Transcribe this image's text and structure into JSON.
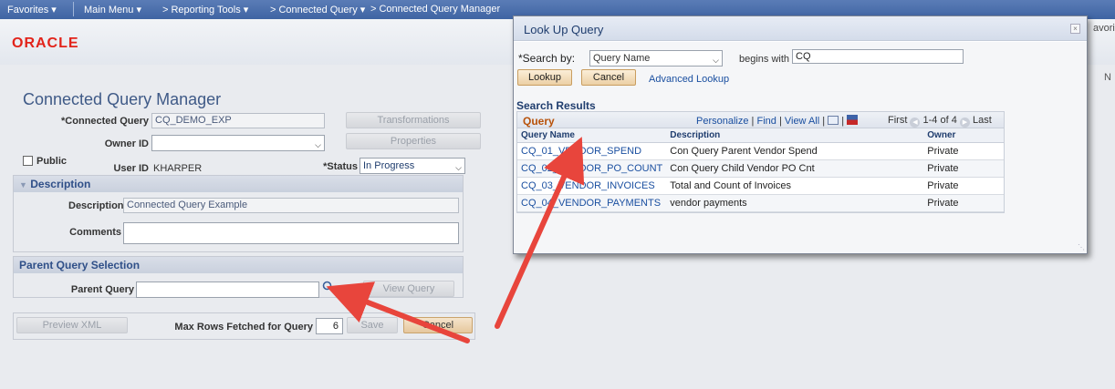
{
  "topbar": {
    "favorites": "Favorites ▾",
    "main_menu": "Main Menu ▾",
    "breadcrumb_1": "> Reporting Tools ▾",
    "breadcrumb_2": "> Connected Query ▾",
    "breadcrumb_3": "> Connected Query Manager",
    "right_text": "avorites"
  },
  "branding": {
    "logo": "ORACLE",
    "right_n": "N"
  },
  "page": {
    "title": "Connected Query Manager",
    "connected_query_label": "*Connected Query",
    "connected_query_value": "CQ_DEMO_EXP",
    "transformations_button": "Transformations",
    "owner_id_label": "Owner ID",
    "owner_id_value": "",
    "properties_button": "Properties",
    "public_label": "Public",
    "user_id_label": "User ID",
    "user_id_value": "KHARPER",
    "status_label": "*Status",
    "status_value": "In Progress"
  },
  "description_group": {
    "header": "Description",
    "description_label": "Description",
    "description_value": "Connected Query Example",
    "comments_label": "Comments",
    "comments_value": ""
  },
  "parent_group": {
    "header": "Parent Query Selection",
    "parent_query_label": "Parent Query",
    "parent_query_value": "",
    "view_query_button": "View Query"
  },
  "bottom": {
    "preview_xml_button": "Preview XML",
    "max_rows_label": "Max Rows Fetched for Query",
    "max_rows_value": "6",
    "save_button": "Save",
    "cancel_button": "Cancel"
  },
  "modal": {
    "title": "Look Up Query",
    "close": "×",
    "search_by_label": "*Search by:",
    "search_by_value": "Query Name",
    "begins_with_label": "begins with",
    "begins_with_value": "CQ",
    "lookup_button": "Lookup",
    "cancel_button": "Cancel",
    "advanced_lookup": "Advanced Lookup",
    "results_title": "Search Results",
    "grid_title": "Query",
    "personalize": "Personalize",
    "find": "Find",
    "view_all": "View All",
    "first": "First",
    "range": "1-4 of 4",
    "last": "Last",
    "columns": [
      "Query Name",
      "Description",
      "Owner"
    ],
    "rows": [
      {
        "name": "CQ_01_VENDOR_SPEND",
        "description": "Con Query Parent Vendor Spend",
        "owner": "Private"
      },
      {
        "name": "CQ_02_VENDOR_PO_COUNT",
        "description": "Con Query Child Vendor PO Cnt",
        "owner": "Private"
      },
      {
        "name": "CQ_03_VENDOR_INVOICES",
        "description": "Total and Count of Invoices",
        "owner": "Private"
      },
      {
        "name": "CQ_04_VENDOR_PAYMENTS",
        "description": "vendor payments",
        "owner": "Private"
      }
    ]
  },
  "colors": {
    "nav_bar": "#4a6fad",
    "accent_title": "#3f5a87",
    "link": "#1a4fa0",
    "annotation_arrow": "#e8453c",
    "oracle_red": "#e2231a"
  }
}
